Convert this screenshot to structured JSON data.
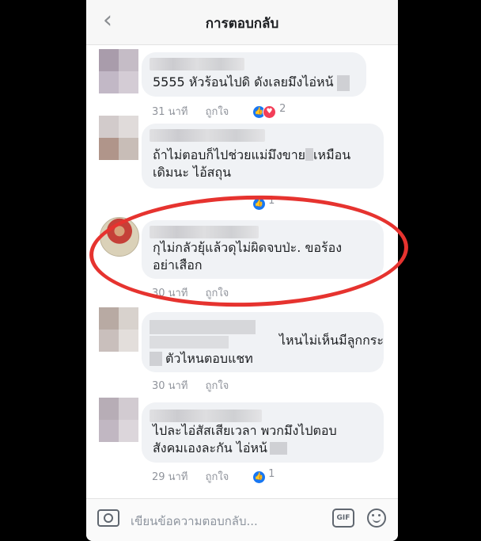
{
  "header": {
    "title": "การตอบกลับ",
    "back_icon": "chevron-left-icon"
  },
  "comments": [
    {
      "text": [
        "5555 หัวร้อนไปดิ ดังเลยมึงไอ่หน้"
      ],
      "time": "31 นาที",
      "like": "ถูกใจ",
      "reaction_count": "2",
      "reactions": [
        "like",
        "love"
      ]
    },
    {
      "text": [
        "ถ้าไม่ตอบก็ไปช่วยแม่มึงขาย",
        "เหมือน",
        "เดิมนะ ไอ้สถุน"
      ],
      "time": "",
      "like": "",
      "reaction_count": "1",
      "reactions": [
        "like"
      ]
    },
    {
      "text": [
        "กุไม่กลัวยุ้แล้วดุไม่ผิดจบป่ะ. ขอร้อง",
        "อย่าเสือก"
      ],
      "time": "30 นาที",
      "like": "ถูกใจ",
      "reaction_count": "",
      "reactions": []
    },
    {
      "text": [
        "ไหนไม่เห็นมีลูกกระ",
        "ตัวไหนตอบแชท"
      ],
      "time": "30 นาที",
      "like": "ถูกใจ",
      "reaction_count": "",
      "reactions": []
    },
    {
      "text": [
        "ไปละไอ่สัสเสียเวลา พวกมึงไปตอบ",
        "สังคมเองละกัน ไอ่หน้"
      ],
      "time": "29 นาที",
      "like": "ถูกใจ",
      "reaction_count": "1",
      "reactions": [
        "like"
      ]
    }
  ],
  "footer": {
    "placeholder": "เขียนข้อความตอบกลับ...",
    "gif_label": "GIF",
    "camera_icon": "camera-icon",
    "emoji_icon": "emoji-icon"
  },
  "colors": {
    "annotation": "#e6332f",
    "like": "#1877f2",
    "love": "#f33e58",
    "bubble": "#f0f2f5"
  }
}
